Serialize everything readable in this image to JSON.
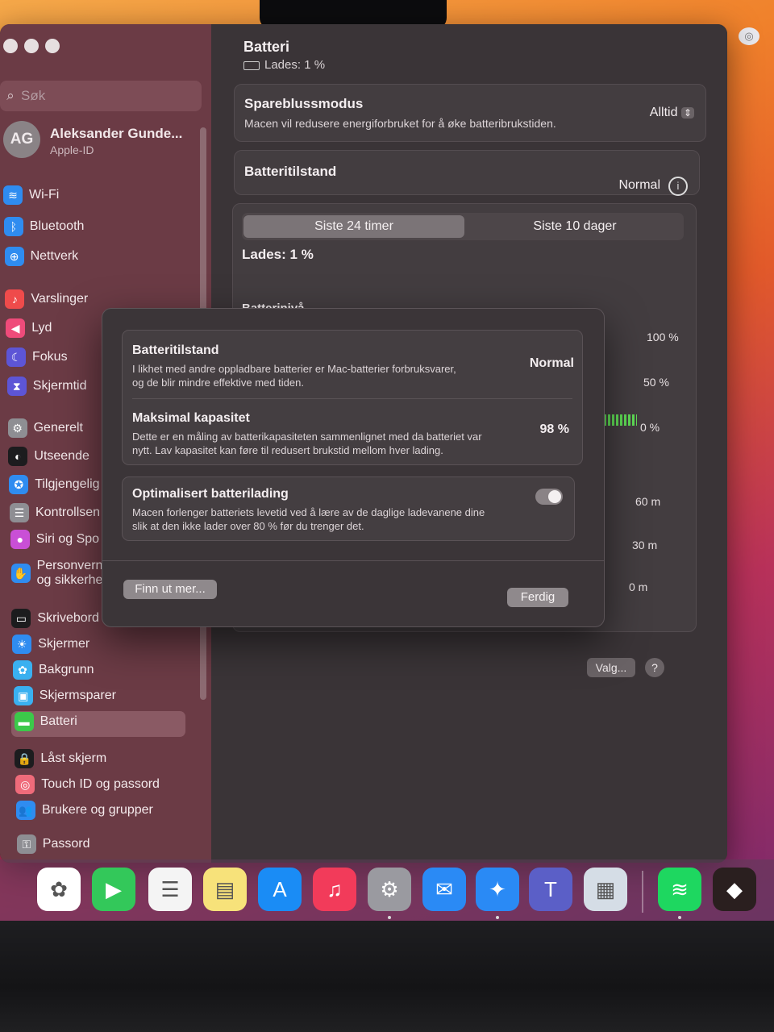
{
  "sidebar": {
    "search_placeholder": "Søk",
    "profile": {
      "initials": "AG",
      "name": "Aleksander Gunde...",
      "subtitle": "Apple-ID"
    },
    "items": [
      {
        "label": "Wi-Fi",
        "icon": "wifi-icon",
        "color": "#2f8cf0"
      },
      {
        "label": "Bluetooth",
        "icon": "bluetooth-icon",
        "color": "#2f8cf0"
      },
      {
        "label": "Nettverk",
        "icon": "globe-icon",
        "color": "#2f8cf0"
      },
      {
        "label": "Varslinger",
        "icon": "bell-icon",
        "color": "#ef4b4b"
      },
      {
        "label": "Lyd",
        "icon": "speaker-icon",
        "color": "#ef4b7a"
      },
      {
        "label": "Fokus",
        "icon": "moon-icon",
        "color": "#5d55d6"
      },
      {
        "label": "Skjermtid",
        "icon": "hourglass-icon",
        "color": "#5d55d6"
      },
      {
        "label": "Generelt",
        "icon": "gear-icon",
        "color": "#8e8e93"
      },
      {
        "label": "Utseende",
        "icon": "appearance-icon",
        "color": "#1c1c1e"
      },
      {
        "label": "Tilgjengelig",
        "icon": "accessibility-icon",
        "color": "#2f8cf0"
      },
      {
        "label": "Kontrollsen",
        "icon": "control-center-icon",
        "color": "#8e8e93"
      },
      {
        "label": "Siri og Spo",
        "icon": "siri-icon",
        "color": "#c94fd6"
      },
      {
        "label": "Personvern",
        "label2": "og sikkerhe",
        "icon": "hand-icon",
        "color": "#2f8cf0"
      },
      {
        "label": "Skrivebord og Dock",
        "icon": "dock-icon",
        "color": "#1c1c1e"
      },
      {
        "label": "Skjermer",
        "icon": "sun-icon",
        "color": "#2f8cf0"
      },
      {
        "label": "Bakgrunn",
        "icon": "flower-icon",
        "color": "#3ab0f0"
      },
      {
        "label": "Skjermsparer",
        "icon": "screensaver-icon",
        "color": "#3ab0f0"
      },
      {
        "label": "Batteri",
        "icon": "battery-icon",
        "color": "#3cc94a"
      },
      {
        "label": "Låst skjerm",
        "icon": "lock-icon",
        "color": "#1c1c1e"
      },
      {
        "label": "Touch ID og passord",
        "icon": "fingerprint-icon",
        "color": "#ef6b7a"
      },
      {
        "label": "Brukere og grupper",
        "icon": "users-icon",
        "color": "#2f8cf0"
      },
      {
        "label": "Passord",
        "icon": "key-icon",
        "color": "#8e8e93"
      }
    ]
  },
  "main": {
    "title": "Batteri",
    "subtitle": "Lades: 1 %",
    "low_power": {
      "title": "Spareblussmodus",
      "desc": "Macen vil redusere energiforbruket for å øke batteribrukstiden.",
      "value": "Alltid"
    },
    "health": {
      "title": "Batteritilstand",
      "value": "Normal"
    },
    "tabs": [
      "Siste 24 timer",
      "Siste 10 dager"
    ],
    "charging": "Lades: 1 %",
    "level_label": "Batterinivå",
    "level_ticks": [
      "100 %",
      "50 %",
      "0 %"
    ],
    "usage_ticks": [
      "60 m",
      "30 m",
      "0 m"
    ],
    "options_button": "Valg...",
    "help_button": "?"
  },
  "modal": {
    "health_title": "Batteritilstand",
    "health_value": "Normal",
    "health_desc_1": "I likhet med andre oppladbare batterier er Mac-batterier forbruksvarer,",
    "health_desc_2": "og de blir mindre effektive med tiden.",
    "capacity_title": "Maksimal kapasitet",
    "capacity_value": "98 %",
    "capacity_desc_1": "Dette er en måling av batterikapasiteten sammenlignet med da batteriet var",
    "capacity_desc_2": "nytt. Lav kapasitet kan føre til redusert brukstid mellom hver lading.",
    "optimized_title": "Optimalisert batterilading",
    "optimized_desc_1": "Macen forlenger batteriets levetid ved å lære av de daglige ladevanene dine",
    "optimized_desc_2": "slik at den ikke lader over 80 % før du trenger det.",
    "optimized_enabled": true,
    "learn_more": "Finn ut mer...",
    "done": "Ferdig"
  },
  "dock": [
    {
      "icon": "photos-icon",
      "color": "#ffffff"
    },
    {
      "icon": "facetime-icon",
      "color": "#33c85a"
    },
    {
      "icon": "reminders-icon",
      "color": "#f4f4f4"
    },
    {
      "icon": "notes-icon",
      "color": "#f7e27a"
    },
    {
      "icon": "app-store-icon",
      "color": "#1a8cf5"
    },
    {
      "icon": "music-icon",
      "color": "#f23b5a"
    },
    {
      "icon": "system-settings-icon",
      "color": "#9a9aa0"
    },
    {
      "icon": "mail-icon",
      "color": "#2a8af5"
    },
    {
      "icon": "safari-icon",
      "color": "#2a8af5"
    },
    {
      "icon": "teams-icon",
      "color": "#5b5fc7"
    },
    {
      "icon": "preview-icon",
      "color": "#d5dde6"
    },
    {
      "icon": "spotify-icon",
      "color": "#1ed760"
    },
    {
      "icon": "metamask-icon",
      "color": "#2a1f1f"
    }
  ]
}
